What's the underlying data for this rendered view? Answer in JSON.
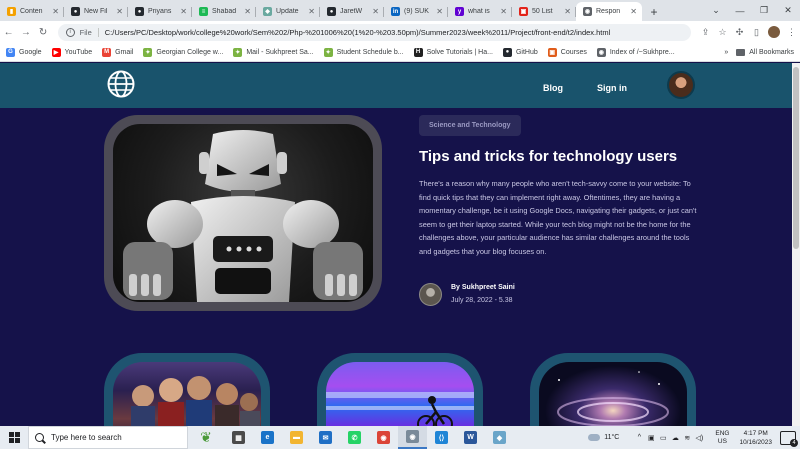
{
  "browser": {
    "tabs": [
      {
        "title": "Conten",
        "color": "#f4a100",
        "glyph": "▮",
        "active": false
      },
      {
        "title": "New Fil",
        "color": "#24292f",
        "glyph": "●",
        "active": false
      },
      {
        "title": "Priyans",
        "color": "#24292f",
        "glyph": "●",
        "active": false
      },
      {
        "title": "Shabad",
        "color": "#1db954",
        "glyph": "≡",
        "active": false
      },
      {
        "title": "Update",
        "color": "#6aa9a0",
        "glyph": "◆",
        "active": false
      },
      {
        "title": "JaretW",
        "color": "#24292f",
        "glyph": "●",
        "active": false
      },
      {
        "title": "(9) SUK",
        "color": "#0a66c2",
        "glyph": "in",
        "active": false
      },
      {
        "title": "what is",
        "color": "#6001d2",
        "glyph": "y",
        "active": false
      },
      {
        "title": "50 List",
        "color": "#e2231a",
        "glyph": "▣",
        "active": false
      },
      {
        "title": "Respon",
        "color": "#5f6368",
        "glyph": "◉",
        "active": true
      }
    ],
    "window_controls": [
      "⌄",
      "—",
      "❐",
      "✕"
    ],
    "address": {
      "chip": "File",
      "url": "C:/Users/PC/Desktop/work/college%20work/Sem%202/Php-%201006%20(1%20-%203.50pm)/Summer2023/week%2011/Project/front-end/t2/index.html"
    },
    "bookmarks": [
      {
        "label": "Google",
        "color": "#4285f4",
        "glyph": "G"
      },
      {
        "label": "YouTube",
        "color": "#ff0000",
        "glyph": "▶"
      },
      {
        "label": "Gmail",
        "color": "#ea4335",
        "glyph": "M"
      },
      {
        "label": "Georgian College w...",
        "color": "#7cb342",
        "glyph": "✦"
      },
      {
        "label": "Mail - Sukhpreet Sa...",
        "color": "#7cb342",
        "glyph": "✦"
      },
      {
        "label": "Student Schedule b...",
        "color": "#7cb342",
        "glyph": "✦"
      },
      {
        "label": "Solve Tutorials | Ha...",
        "color": "#222222",
        "glyph": "H"
      },
      {
        "label": "GitHub",
        "color": "#24292f",
        "glyph": "●"
      },
      {
        "label": "Courses",
        "color": "#e05c1a",
        "glyph": "▣"
      },
      {
        "label": "Index of /~Sukhpre...",
        "color": "#5f6368",
        "glyph": "◉"
      }
    ],
    "bookmarks_overflow": "»",
    "all_bookmarks": "All Bookmarks"
  },
  "site": {
    "nav": {
      "blog": "Blog",
      "signin": "Sign in"
    },
    "featured": {
      "category": "Science and Technology",
      "title": "Tips and tricks for technology users",
      "body": "There's a reason why many people who aren't tech-savvy come to your website: To find quick tips that they can implement right away. Oftentimes, they are having a momentary challenge, be it using Google Docs, navigating their gadgets, or just can't seem to get their laptop started. While your tech blog might not be the home for the challenges above, your particular audience has similar challenges around the tools and gadgets that your blog focuses on.",
      "author": "By Sukhpreet Saini",
      "date": "July 28, 2022 - 5.38"
    }
  },
  "taskbar": {
    "search_placeholder": "Type here to search",
    "apps": [
      {
        "name": "task-view",
        "color": "#4a4a4a",
        "glyph": "▦",
        "active": false
      },
      {
        "name": "edge",
        "color": "#1a73c8",
        "glyph": "e",
        "active": false
      },
      {
        "name": "file-explorer",
        "color": "#f2b531",
        "glyph": "▬",
        "active": false
      },
      {
        "name": "mail",
        "color": "#1f6fc5",
        "glyph": "✉",
        "active": false
      },
      {
        "name": "whatsapp",
        "color": "#25d366",
        "glyph": "✆",
        "active": false
      },
      {
        "name": "chrome",
        "color": "#db4437",
        "glyph": "◉",
        "active": false
      },
      {
        "name": "chrome-active",
        "color": "#7a8a99",
        "glyph": "◉",
        "active": true
      },
      {
        "name": "vscode",
        "color": "#1f85d6",
        "glyph": "⟨⟩",
        "active": false
      },
      {
        "name": "word",
        "color": "#2b579a",
        "glyph": "W",
        "active": false
      },
      {
        "name": "app",
        "color": "#6aa5c9",
        "glyph": "◆",
        "active": false
      }
    ],
    "weather": "11°C",
    "lang_top": "ENG",
    "lang_bottom": "US",
    "time": "4:17 PM",
    "date": "10/16/2023",
    "notification_count": "4"
  }
}
